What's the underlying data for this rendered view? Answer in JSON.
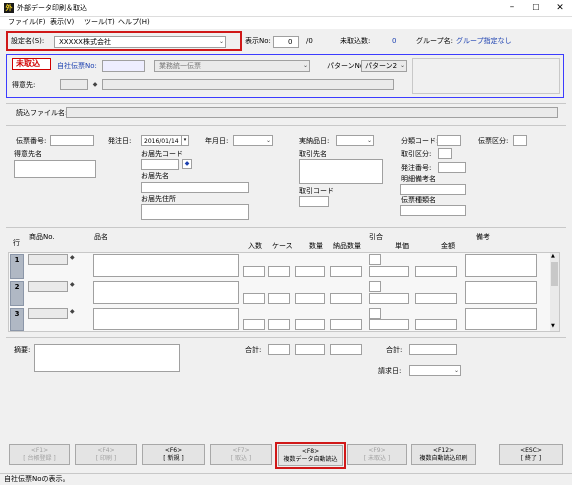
{
  "window": {
    "title": "外部データ印刷＆取込"
  },
  "menu": [
    "ファイル(F)",
    "表示(V)",
    "ツール(T)",
    "ヘルプ(H)"
  ],
  "top": {
    "settings_label": "設定名(S):",
    "settings_value": "XXXXX株式会社",
    "display_label": "表示No:",
    "display_value": "0",
    "display_total": "/0",
    "untaken_label": "未取込数:",
    "untaken_value": "0",
    "group_label": "グループ名:",
    "group_value": "グループ指定なし"
  },
  "panel": {
    "status": "未取込",
    "slip_label": "自社伝票No:",
    "slip_type": "業務統一伝票",
    "pattern_label": "パターンNo:",
    "pattern_value": "パターン2",
    "customer_label": "得意先:"
  },
  "read_file_label": "読込ファイル名:",
  "form": {
    "slip_no": "伝票番号:",
    "order_date": "発注日:",
    "order_date_value": "2016/01/14",
    "year_month": "年月日:",
    "delivery_item": "実納品日:",
    "category_code": "分類コード:",
    "slip_kind": "伝票区分:",
    "customer_name": "得意先名",
    "dest_code": "お届先コード",
    "partner_name": "取引先名",
    "trade_kind": "取引区分:",
    "dest_name": "お届先名",
    "dispatch_no": "発注番号:",
    "detail_remark": "明細備考名",
    "partner_code": "取引コード",
    "dest_address": "お届先住所",
    "slip_kind_name": "伝票種類名"
  },
  "grid": {
    "row_label": "行",
    "item_no": "商品No.",
    "name": "品名",
    "qty": "入数",
    "case": "ケース",
    "quantity": "数量",
    "delivered_qty": "納品数量",
    "discount": "引合",
    "unit_price": "単価",
    "amount": "金額",
    "remarks": "備考",
    "rows": [
      "1",
      "2",
      "3"
    ]
  },
  "footer": {
    "summary_label": "摘要:",
    "total_label": "合計:",
    "total2_label": "合計:",
    "billing_label": "請求日:"
  },
  "buttons": [
    {
      "key": "<F1>",
      "label": "[ 台帳登録 ]",
      "enabled": false
    },
    {
      "key": "<F4>",
      "label": "[ 印刷 ]",
      "enabled": false
    },
    {
      "key": "<F6>",
      "label": "[ 新規 ]",
      "enabled": true
    },
    {
      "key": "<F7>",
      "label": "[ 取込 ]",
      "enabled": false
    },
    {
      "key": "<F8>",
      "label": "複数データ自動読込",
      "enabled": true
    },
    {
      "key": "<F9>",
      "label": "[ 未取込 ]",
      "enabled": false
    },
    {
      "key": "<F12>",
      "label": "複数自動読込印刷",
      "enabled": true
    },
    {
      "key": "<ESC>",
      "label": "[ 終了 ]",
      "enabled": true
    }
  ],
  "status_bar": "自社伝票Noの表示。",
  "colors": {
    "highlight": "#d01818",
    "panel_border": "#3c3cff",
    "blue_text": "#1a3fb0",
    "row_header": "#b0b8c4"
  }
}
